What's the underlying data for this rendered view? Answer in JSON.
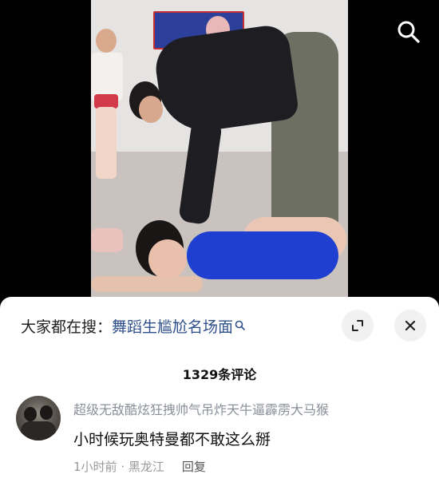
{
  "search_label": "搜索",
  "panel": {
    "search_prefix": "大家都在搜：",
    "search_query": "舞蹈生尴尬名场面",
    "comment_count_text": "1329条评论"
  },
  "comment": {
    "username": "超级无敌酷炫狂拽帅气吊炸天牛逼霹雳大马猴",
    "text": "小时候玩奥特曼都不敢这么掰",
    "time": "1小时前",
    "location": "黑龙江",
    "reply_label": "回复"
  },
  "colors": {
    "query_link": "#2f4f8a",
    "muted": "#8a8f99"
  },
  "icons": [
    "search-icon",
    "expand-icon",
    "close-icon",
    "small-search-icon"
  ]
}
